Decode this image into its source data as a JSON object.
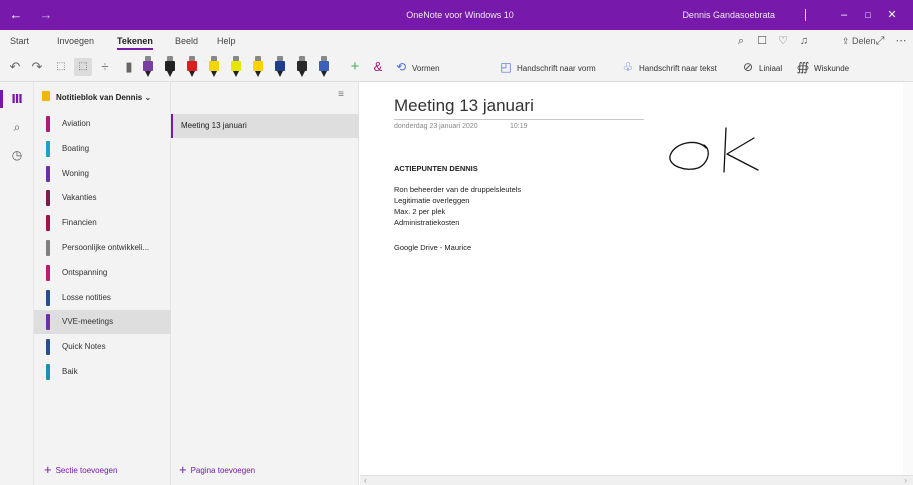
{
  "window": {
    "title": "OneNote voor Windows 10",
    "user": "Dennis Gandasoebrata",
    "accent": "#7719aa"
  },
  "ribbon": {
    "tabs": [
      "Start",
      "Invoegen",
      "Tekenen",
      "Beeld",
      "Help"
    ],
    "active_tab": "Tekenen",
    "share_label": "Delen"
  },
  "draw_toolbar": {
    "shapes_label": "Vormen",
    "ink_to_shape_label": "Handschrift naar vorm",
    "ink_to_text_label": "Handschrift naar tekst",
    "ruler_label": "Liniaal",
    "math_label": "Wiskunde",
    "pen_colors": [
      "#7a3da0",
      "#222222",
      "#d81e1e",
      "#f2d600",
      "#e6e600",
      "#ffd200",
      "#1f3f8c",
      "#2a2a2a",
      "#3c5fb8"
    ]
  },
  "notebook": {
    "name": "Notitieblok van Dennis",
    "sections": [
      {
        "label": "Aviation",
        "color": "#b0177a"
      },
      {
        "label": "Boating",
        "color": "#1aa3c7"
      },
      {
        "label": "Woning",
        "color": "#6b2fa8"
      },
      {
        "label": "Vakanties",
        "color": "#7a1e4e"
      },
      {
        "label": "Financien",
        "color": "#a3144b"
      },
      {
        "label": "Persoonlijke ontwikkeli...",
        "color": "#808080"
      },
      {
        "label": "Ontspanning",
        "color": "#c3186f"
      },
      {
        "label": "Losse notities",
        "color": "#2a4d8f"
      },
      {
        "label": "VVE-meetings",
        "color": "#6b2fa8"
      },
      {
        "label": "Quick Notes",
        "color": "#2a4d8f"
      },
      {
        "label": "Baik",
        "color": "#1e8fb5"
      }
    ],
    "selected_section": "VVE-meetings",
    "add_section_label": "Sectie toevoegen"
  },
  "pages": {
    "items": [
      "Meeting 13 januari"
    ],
    "add_page_label": "Pagina toevoegen"
  },
  "page": {
    "title": "Meeting 13 januari",
    "date": "donderdag 23 januari 2020",
    "time": "10:19",
    "heading": "ACTIEPUNTEN DENNIS",
    "lines": [
      "Ron beheerder van de druppelsleutels",
      "Legitimatie overleggen",
      "Max. 2 per plek",
      "Administratiekosten",
      "",
      "Google Drive - Maurice"
    ],
    "ink_text": "ok"
  }
}
